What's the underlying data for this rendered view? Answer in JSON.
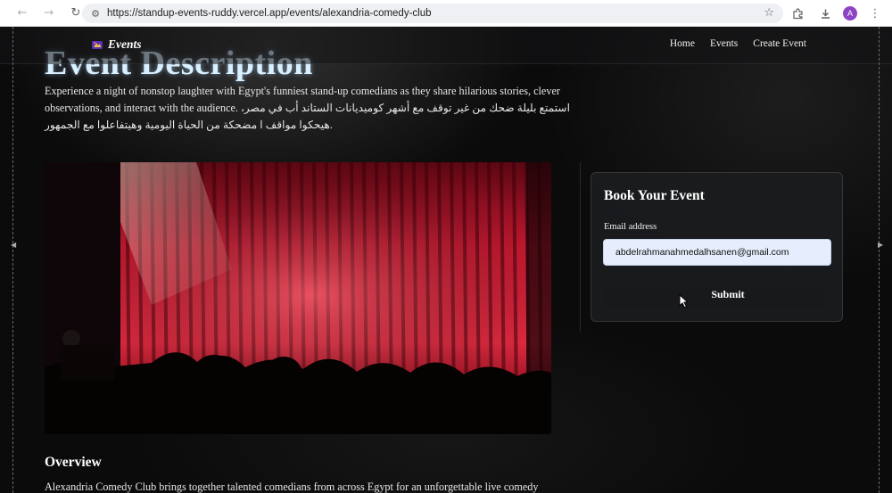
{
  "browser": {
    "url": "https://standup-events-ruddy.vercel.app/events/alexandria-comedy-club",
    "profile_initial": "A",
    "icons": [
      "back-icon",
      "forward-icon",
      "reload-icon",
      "site-settings-icon",
      "bookmark-star-icon",
      "extensions-icon",
      "download-icon",
      "menu-kebab-icon"
    ]
  },
  "header": {
    "logo_text": "Events",
    "nav": [
      "Home",
      "Events",
      "Create Event"
    ]
  },
  "main": {
    "section_title": "Event Description",
    "description_en": "Experience a night of nonstop laughter with Egypt's funniest stand-up comedians as they share hilarious stories, clever observations, and interact with the audience.",
    "description_ar": "استمتع بليلة ضحك من غير توقف مع أشهر كوميديانات الستاند أب في مصر، هيحكوا مواقف ا مضحكة من الحياة اليومية وهيتفاعلوا مع الجمهور."
  },
  "booking": {
    "title": "Book Your Event",
    "email_label": "Email address",
    "email_value": "abdelrahmanahmedalhsanen@gmail.com",
    "submit_label": "Submit"
  },
  "overview": {
    "title": "Overview",
    "text": "Alexandria Comedy Club brings together talented comedians from across Egypt for an unforgettable live comedy"
  },
  "colors": {
    "page_bg": "#0b0b0c",
    "input_bg": "#e6eefd",
    "curtain_red": "#b3122a",
    "logo_purple": "#7b3fd1"
  }
}
